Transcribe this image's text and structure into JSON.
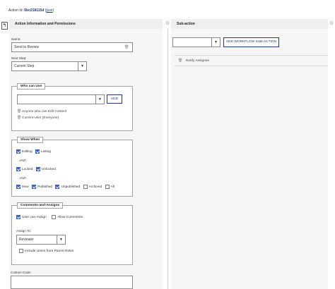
{
  "header": {
    "action_id_label": "Action Id:",
    "action_id_value": "6bc218115d",
    "json_link": "json"
  },
  "back_button": "↰",
  "left_panel": {
    "title": "Action Information and Permissions",
    "name_label": "Name:",
    "name_value": "Send to Review",
    "next_step_label": "Next Step:",
    "next_step_value": "Current Step",
    "who_can_use": {
      "legend": "Who can Use",
      "add_label": "ADD",
      "items": [
        "Anyone who can Edit Content",
        "Current User (Everyone)"
      ]
    },
    "show_when": {
      "legend": "Show When",
      "row1": [
        {
          "label": "Editing",
          "checked": true
        },
        {
          "label": "Listing",
          "checked": true
        }
      ],
      "and1": "AND",
      "row2": [
        {
          "label": "Locked",
          "checked": true
        },
        {
          "label": "Unlocked",
          "checked": true
        }
      ],
      "and2": "AND",
      "row3": [
        {
          "label": "New",
          "checked": true
        },
        {
          "label": "Published",
          "checked": true
        },
        {
          "label": "Unpublished",
          "checked": true
        },
        {
          "label": "Archived",
          "checked": false
        },
        {
          "label": "All",
          "checked": false
        }
      ]
    },
    "comments": {
      "legend": "Comments-and-Assigns",
      "user_can_assign": "User can Assign",
      "allow_comments": "Allow Comments",
      "assign_to_label": "Assign To:",
      "assign_to_value": "Reviewer",
      "include_users": "Include Users from Parent Roles"
    },
    "custom_code_label": "Custom Code:"
  },
  "right_panel": {
    "title": "Sub-action",
    "add_label": "ADD WORKFLOW SUB-ACTION",
    "items": [
      "Notify Assignee"
    ]
  },
  "colors": {
    "accent": "#3a63c7",
    "link": "#1c3a7a"
  }
}
